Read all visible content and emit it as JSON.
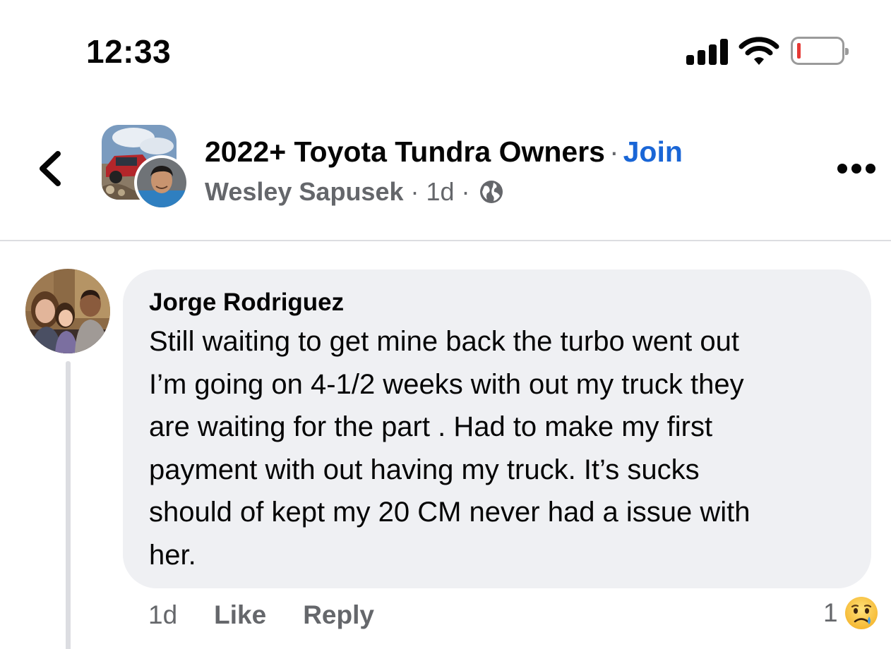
{
  "status_bar": {
    "time": "12:33",
    "icons": [
      "cellular-signal-icon",
      "wifi-icon",
      "battery-low-icon"
    ],
    "battery_color": "#e53935"
  },
  "header": {
    "back_icon": "chevron-left-icon",
    "group_name": "2022+ Toyota Tundra Owners",
    "separator": "·",
    "join_label": "Join",
    "author": "Wesley Sapusek",
    "meta_separator": "·",
    "time_ago": "1d",
    "audience_icon": "globe-icon",
    "more_icon": "more-horizontal-icon",
    "join_color": "#1a66d6"
  },
  "comment": {
    "author": "Jorge Rodriguez",
    "text": "Still waiting to get mine back the turbo went out\nI’m going on 4-1/2 weeks with out my truck they\nare waiting for the part . Had to make my first\npayment with out having my truck. It’s sucks\nshould of kept my 20 CM never had a issue with\nher.",
    "time_ago": "1d",
    "like_label": "Like",
    "reply_label": "Reply",
    "reaction_count": "1",
    "reaction_icon": "sad-face-icon",
    "bubble_color": "#eff0f3"
  }
}
